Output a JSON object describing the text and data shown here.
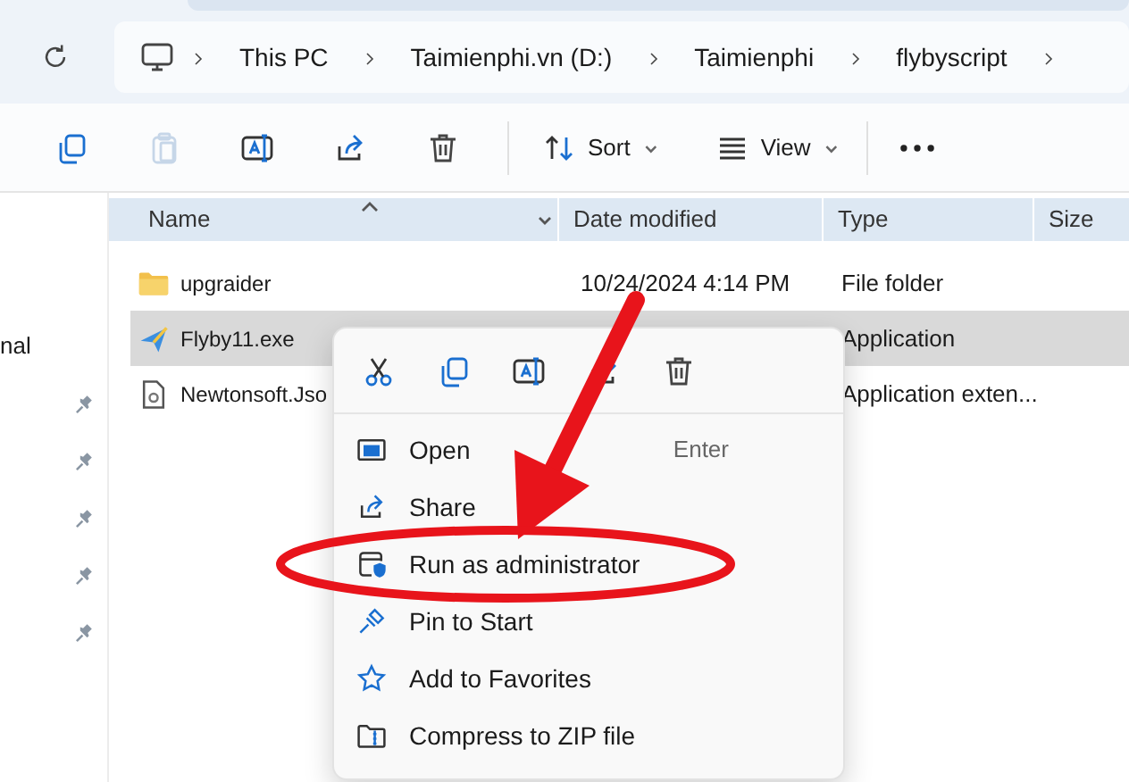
{
  "address_bar": {
    "crumbs": [
      "This PC",
      "Taimienphi.vn (D:)",
      "Taimienphi",
      "flybyscript"
    ]
  },
  "toolbar": {
    "actions": [
      {
        "kind": "copy",
        "disabled": false
      },
      {
        "kind": "paste",
        "disabled": true
      },
      {
        "kind": "rename",
        "disabled": false
      },
      {
        "kind": "share",
        "disabled": false
      },
      {
        "kind": "delete",
        "disabled": false
      }
    ],
    "sort_label": "Sort",
    "view_label": "View"
  },
  "nav_pane": {
    "items": [
      {
        "label": "nal",
        "pinned": false
      },
      {
        "pinned": true
      },
      {
        "pinned": true
      },
      {
        "pinned": true
      },
      {
        "pinned": true
      },
      {
        "pinned": true
      }
    ]
  },
  "columns": [
    {
      "label": "Name",
      "sorted": true
    },
    {
      "label": "Date modified",
      "sorted": false
    },
    {
      "label": "Type",
      "sorted": false
    },
    {
      "label": "Size",
      "sorted": false
    }
  ],
  "rows": [
    {
      "kind": "folder",
      "name": "upgraider",
      "date": "10/24/2024 4:14 PM",
      "type": "File folder",
      "selected": false
    },
    {
      "kind": "app",
      "name": "Flyby11.exe",
      "type": "Application",
      "selected": true
    },
    {
      "kind": "file",
      "name": "Newtonsoft.Jso",
      "type": "Application exten...",
      "selected": false
    }
  ],
  "context_menu": {
    "quick_actions": [
      {
        "kind": "cut"
      },
      {
        "kind": "copy"
      },
      {
        "kind": "rename"
      },
      {
        "kind": "share"
      },
      {
        "kind": "delete"
      }
    ],
    "items": [
      {
        "kind": "open",
        "label": "Open",
        "shortcut": "Enter"
      },
      {
        "kind": "share",
        "label": "Share"
      },
      {
        "kind": "admin",
        "label": "Run as administrator"
      },
      {
        "kind": "pin",
        "label": "Pin to Start"
      },
      {
        "kind": "favorite",
        "label": "Add to Favorites"
      },
      {
        "kind": "zip",
        "label": "Compress to ZIP file"
      }
    ]
  },
  "annotations": {
    "arrow": true,
    "ellipse": true
  }
}
